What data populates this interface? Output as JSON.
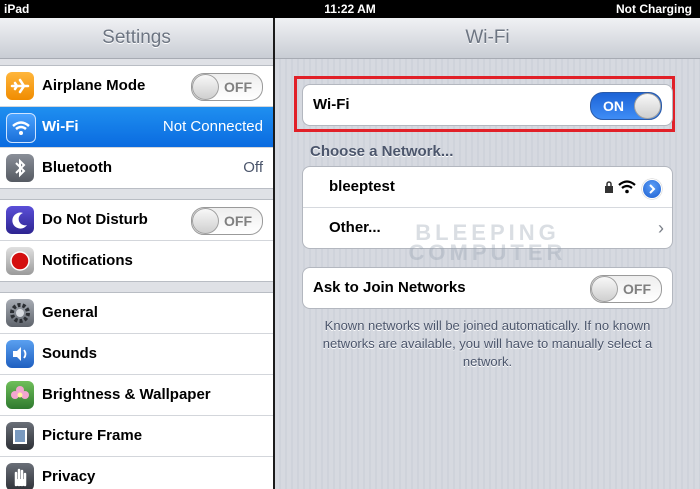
{
  "status_bar": {
    "carrier": "iPad",
    "time": "11:22 AM",
    "battery": "Not Charging"
  },
  "left_pane": {
    "title": "Settings",
    "groups": [
      {
        "items": [
          {
            "label": "Airplane Mode",
            "icon": "airplane-icon",
            "toggle": "OFF"
          },
          {
            "label": "Wi-Fi",
            "icon": "wifi-icon",
            "value": "Not Connected",
            "selected": true
          },
          {
            "label": "Bluetooth",
            "icon": "bluetooth-icon",
            "value": "Off"
          }
        ]
      },
      {
        "items": [
          {
            "label": "Do Not Disturb",
            "icon": "moon-icon",
            "toggle": "OFF"
          },
          {
            "label": "Notifications",
            "icon": "notifications-icon"
          }
        ]
      },
      {
        "items": [
          {
            "label": "General",
            "icon": "gear-icon"
          },
          {
            "label": "Sounds",
            "icon": "speaker-icon"
          },
          {
            "label": "Brightness & Wallpaper",
            "icon": "flower-icon"
          },
          {
            "label": "Picture Frame",
            "icon": "picture-frame-icon"
          },
          {
            "label": "Privacy",
            "icon": "hand-icon"
          }
        ]
      }
    ]
  },
  "right_pane": {
    "title": "Wi-Fi",
    "wifi_row": {
      "label": "Wi-Fi",
      "toggle": "ON"
    },
    "section_header": "Choose a Network...",
    "networks": [
      {
        "name": "bleeptest"
      },
      {
        "name": "Other..."
      }
    ],
    "ask_to_join": {
      "label": "Ask to Join Networks",
      "toggle": "OFF"
    },
    "footer": "Known networks will be joined automatically. If no known networks are available, you will have to manually select a network.",
    "watermark": [
      "BLEEPING",
      "COMPUTER"
    ]
  },
  "colors": {
    "selected_row": "#1279e8",
    "highlight_box": "#e12028",
    "toggle_on": "#2e79ea"
  }
}
